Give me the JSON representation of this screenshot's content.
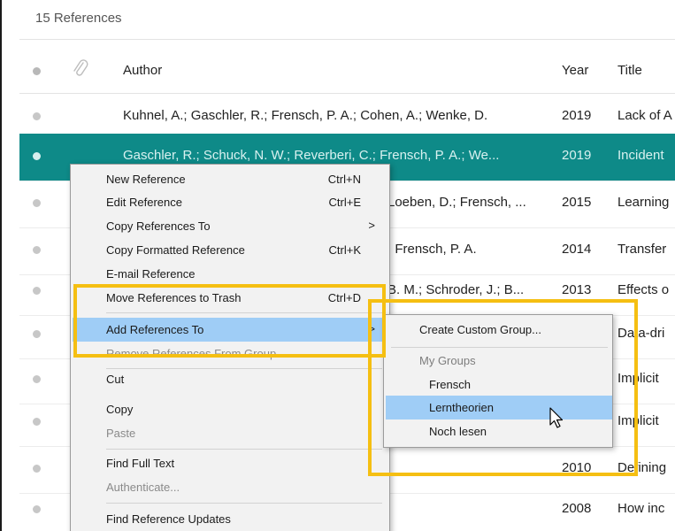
{
  "toolbar": {
    "count_label": "15 References"
  },
  "columns": {
    "author": "Author",
    "year": "Year",
    "title": "Title"
  },
  "rows": [
    {
      "author": "Kuhnel, A.; Gaschler, R.; Frensch, P. A.; Cohen, A.; Wenke, D.",
      "year": "2019",
      "title": "Lack of A"
    },
    {
      "author": "Gaschler, R.; Schuck, N. W.; Reverberi, C.; Frensch, P. A.; We...",
      "year": "2019",
      "title": "Incident"
    },
    {
      "author": "Loeben, D.; Frensch, ...",
      "year": "2015",
      "title": "Learning"
    },
    {
      "author": "; Frensch, P. A.",
      "year": "2014",
      "title": "Transfer"
    },
    {
      "author": "B. M.; Schroder, J.; B...",
      "year": "2013",
      "title": "Effects o"
    },
    {
      "author": "",
      "year": "",
      "title": "Data-dri"
    },
    {
      "author": "",
      "year": "",
      "title": "Implicit"
    },
    {
      "author": "",
      "year": "",
      "title": "Implicit"
    },
    {
      "author": "",
      "year": "2010",
      "title": "Defining"
    },
    {
      "author": "",
      "year": "2008",
      "title": "How inc"
    }
  ],
  "context_menu": {
    "new_reference": {
      "label": "New Reference",
      "shortcut": "Ctrl+N"
    },
    "edit_reference": {
      "label": "Edit Reference",
      "shortcut": "Ctrl+E"
    },
    "copy_references_to": {
      "label": "Copy References To",
      "arrow": ">"
    },
    "copy_formatted": {
      "label": "Copy Formatted Reference",
      "shortcut": "Ctrl+K"
    },
    "email_reference": {
      "label": "E-mail Reference"
    },
    "move_to_trash": {
      "label": "Move References to Trash",
      "shortcut": "Ctrl+D"
    },
    "add_references_to": {
      "label": "Add References To",
      "arrow": ">"
    },
    "remove_from_group": {
      "label": "Remove References From Group"
    },
    "cut": {
      "label": "Cut"
    },
    "copy": {
      "label": "Copy"
    },
    "paste": {
      "label": "Paste"
    },
    "find_full_text": {
      "label": "Find Full Text"
    },
    "authenticate": {
      "label": "Authenticate..."
    },
    "find_updates": {
      "label": "Find Reference Updates"
    }
  },
  "submenu": {
    "create_custom_group": "Create Custom Group...",
    "my_groups_header": "My Groups",
    "groups": [
      "Frensch",
      "Lerntheorien",
      "Noch lesen"
    ]
  },
  "colors": {
    "selection": "#0e8a88",
    "highlight": "#9fcdf6",
    "annotation": "#f5bf12"
  }
}
